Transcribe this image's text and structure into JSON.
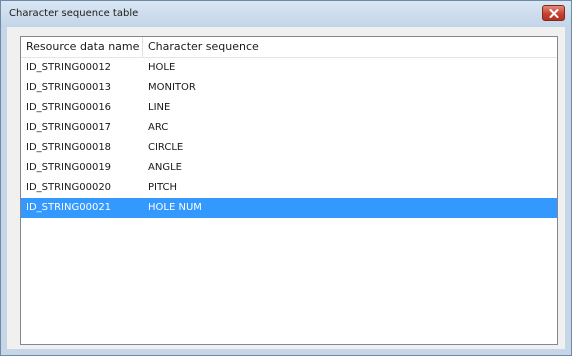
{
  "window": {
    "title": "Character sequence table",
    "close_icon": "close-icon"
  },
  "table": {
    "columns": [
      "Resource data name",
      "Character sequence"
    ],
    "rows": [
      {
        "name": "ID_STRING00012",
        "sequence": "HOLE",
        "selected": false
      },
      {
        "name": "ID_STRING00013",
        "sequence": "MONITOR",
        "selected": false
      },
      {
        "name": "ID_STRING00016",
        "sequence": "LINE",
        "selected": false
      },
      {
        "name": "ID_STRING00017",
        "sequence": "ARC",
        "selected": false
      },
      {
        "name": "ID_STRING00018",
        "sequence": "CIRCLE",
        "selected": false
      },
      {
        "name": "ID_STRING00019",
        "sequence": "ANGLE",
        "selected": false
      },
      {
        "name": "ID_STRING00020",
        "sequence": "PITCH",
        "selected": false
      },
      {
        "name": "ID_STRING00021",
        "sequence": "HOLE NUM",
        "selected": true
      }
    ],
    "selection_color": "#3399ff"
  }
}
